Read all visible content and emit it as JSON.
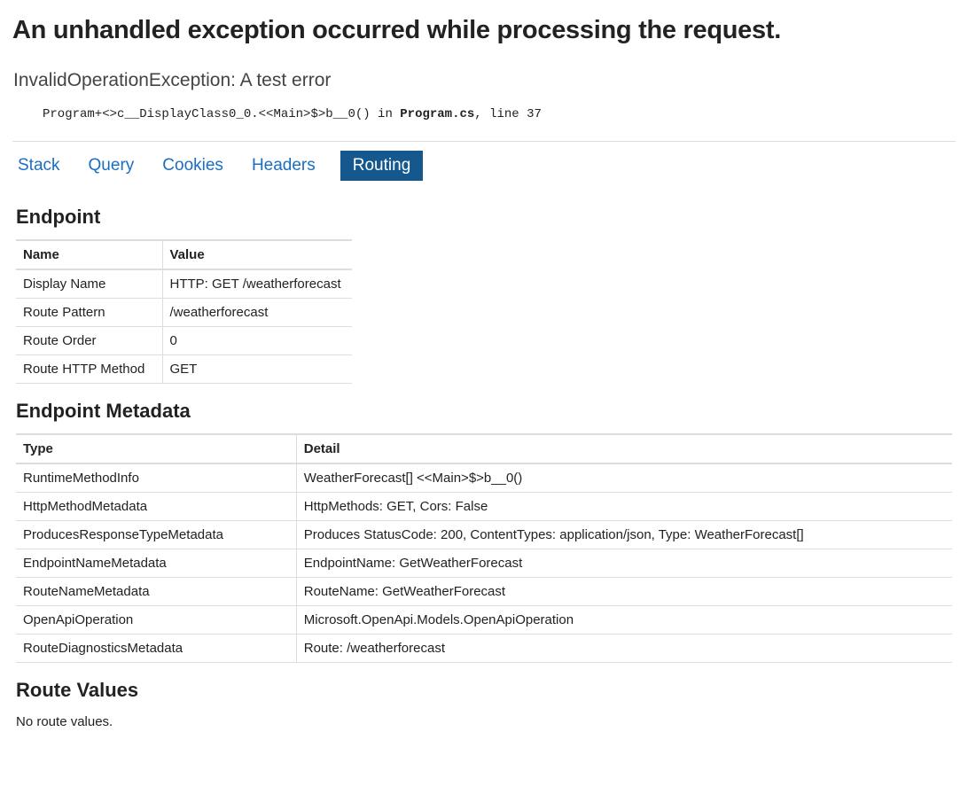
{
  "page_title": "An unhandled exception occurred while processing the request.",
  "exception": "InvalidOperationException: A test error",
  "stack": {
    "method": "Program+<>c__DisplayClass0_0.<<Main>$>b__0() in ",
    "file": "Program.cs",
    "line_suffix": ", line 37"
  },
  "tabs": {
    "stack": "Stack",
    "query": "Query",
    "cookies": "Cookies",
    "headers": "Headers",
    "routing": "Routing"
  },
  "selected_tab": "Routing",
  "sections": {
    "endpoint": "Endpoint",
    "metadata": "Endpoint Metadata",
    "route_values": "Route Values"
  },
  "endpoint_headers": {
    "name": "Name",
    "value": "Value"
  },
  "endpoint_rows": [
    {
      "name": "Display Name",
      "value": "HTTP: GET /weatherforecast"
    },
    {
      "name": "Route Pattern",
      "value": "/weatherforecast"
    },
    {
      "name": "Route Order",
      "value": "0"
    },
    {
      "name": "Route HTTP Method",
      "value": "GET"
    }
  ],
  "metadata_headers": {
    "type": "Type",
    "detail": "Detail"
  },
  "metadata_rows": [
    {
      "type": "RuntimeMethodInfo",
      "detail": "WeatherForecast[] <<Main>$>b__0()"
    },
    {
      "type": "HttpMethodMetadata",
      "detail": "HttpMethods: GET, Cors: False"
    },
    {
      "type": "ProducesResponseTypeMetadata",
      "detail": "Produces StatusCode: 200, ContentTypes: application/json, Type: WeatherForecast[]"
    },
    {
      "type": "EndpointNameMetadata",
      "detail": "EndpointName: GetWeatherForecast"
    },
    {
      "type": "RouteNameMetadata",
      "detail": "RouteName: GetWeatherForecast"
    },
    {
      "type": "OpenApiOperation",
      "detail": "Microsoft.OpenApi.Models.OpenApiOperation"
    },
    {
      "type": "RouteDiagnosticsMetadata",
      "detail": "Route: /weatherforecast"
    }
  ],
  "no_route_values": "No route values."
}
